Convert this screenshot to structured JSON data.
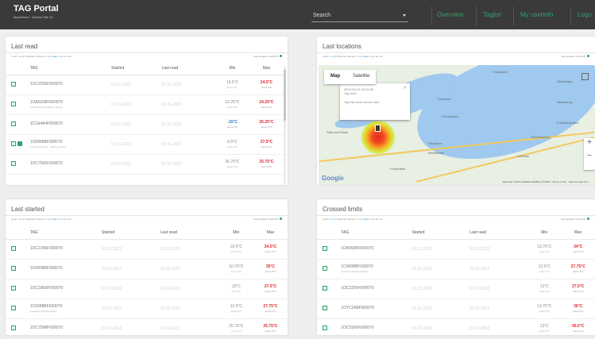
{
  "header": {
    "title": "TAG Portal",
    "subtitle": "MarcelVeni · Demos Site 44",
    "search_label": "Search",
    "nav": [
      "Overview",
      "Taglist",
      "My userinfo",
      "Logo"
    ]
  },
  "colors": {
    "accent": "#2fa36b",
    "max_red": "#e0262f",
    "min_blue": "#2f6fd6",
    "header_bg": "#3a3a3a"
  },
  "last_read": {
    "title": "Last read",
    "meta": {
      "prefix": "Count:",
      "count": "1 2 3 4",
      "text": "Refresh interval: 1 min",
      "link": "Code",
      "suffix": "5 min 10 min"
    },
    "updated": "Last updated: 12:01:06",
    "columns": [
      "",
      "TAG",
      "Started",
      "Last read",
      "Min",
      "Max"
    ],
    "rows": [
      {
        "tag": "1OC2256F000070",
        "sub": "",
        "started": "01.01.2022",
        "read": "01.01.2022",
        "min": "19.5°C",
        "min_sub": "since 3°C",
        "max": "24.5°C",
        "max_sub": "since 3°C",
        "min_blue": false,
        "double": false
      },
      {
        "tag": "1OA520BF000070",
        "sub": "Customer Stone Dustry Testing",
        "started": "01.01.2022",
        "read": "01.01.2022",
        "min": "10.25°C",
        "min_sub": "since 3°C",
        "max": "24.25°C",
        "max_sub": "since 3°C",
        "min_blue": false,
        "double": false
      },
      {
        "tag": "1C1A4A4F000070",
        "sub": "",
        "started": "01.01.2022",
        "read": "01.01.2022",
        "min": "-15°C",
        "min_sub": "since 3°C",
        "max": "25.25°C",
        "max_sub": "since 3°C",
        "min_blue": true,
        "double": false
      },
      {
        "tag": "1O6998BF000070",
        "sub": "Customer Sensor · Data p_sensor",
        "started": "01.01.2022",
        "read": "01.01.2022",
        "min": "6.5°C",
        "min_sub": "since 3°C",
        "max": "37.5°C",
        "max_sub": "since 3°C",
        "min_blue": false,
        "double": true
      },
      {
        "tag": "1OC7566F000070",
        "sub": "",
        "started": "01.01.2022",
        "read": "01.01.2022",
        "min": "25.75°C",
        "min_sub": "since 3°C",
        "max": "25.75°C",
        "max_sub": "since 3°C",
        "min_blue": false,
        "double": false
      }
    ]
  },
  "last_locations": {
    "title": "Last locations",
    "meta": {
      "prefix": "Count:",
      "count": "1 2 3 4",
      "text": "Refresh interval: 1 min",
      "link": "Code",
      "suffix": "5 min 10 min"
    },
    "updated": "Last updated: 12:01:06",
    "map_tab": "Map",
    "satellite_tab": "Satellite",
    "popup": {
      "time": "2023-06-09 18:40:49",
      "title": "Tag read",
      "body": "Tag has been above limit"
    },
    "google": "Google",
    "attribution": "Map data ©2023 GeoBasis-DE/BKG (©2009) · Terms of Use · Report a map error",
    "labels": [
      "Radolfzell",
      "Konstanz",
      "Kreuzlingen",
      "Stein am Rhein",
      "Frauenfeld",
      "Romanshorn",
      "Amriswil",
      "Weinfelden",
      "Steckborn",
      "Überlingen",
      "Meersburg",
      "Friedrichshafen"
    ]
  },
  "last_started": {
    "title": "Last started",
    "meta": {
      "prefix": "Count:",
      "count": "1 2 3 4",
      "text": "Refresh interval: 1 min",
      "link": "Code",
      "suffix": "5 min 10 min"
    },
    "updated": "Last updated: 12:01:06",
    "columns": [
      "",
      "TAG",
      "Started",
      "Last read",
      "Min",
      "Max"
    ],
    "rows": [
      {
        "tag": "1OC2256F000070",
        "sub": "",
        "started": "01.01.2022",
        "read": "01.01.2022",
        "min": "19.5°C",
        "min_sub": "since 3°C",
        "max": "24.5°C",
        "max_sub": "since 3°C"
      },
      {
        "tag": "1O4998BF000070",
        "sub": "",
        "started": "01.01.2022",
        "read": "01.01.2022",
        "min": "10.75°C",
        "min_sub": "since 3°C",
        "max": "35°C",
        "max_sub": "since 3°C"
      },
      {
        "tag": "1OC2A58F000070",
        "sub": "",
        "started": "01.01.2022",
        "read": "01.01.2022",
        "min": "13°C",
        "min_sub": "since 2C",
        "max": "27.5°C",
        "max_sub": "since 3°C"
      },
      {
        "tag": "1C6998BF000070",
        "sub": "Customer Documentation",
        "started": "01.01.2022",
        "read": "01.01.2022",
        "min": "12.5°C",
        "min_sub": "since 3°C",
        "max": "27.75°C",
        "max_sub": "since 3°C"
      },
      {
        "tag": "1OC7568F000070",
        "sub": "",
        "started": "01.01.2022",
        "read": "01.01.2022",
        "min": "25.75°C",
        "min_sub": "since 3°C",
        "max": "25.75°C",
        "max_sub": "since 3°C"
      }
    ]
  },
  "crossed_limits": {
    "title": "Crossed limits",
    "meta": {
      "prefix": "Count:",
      "count": "1 2 3 4",
      "text": "Refresh interval: 1 min",
      "link": "Code",
      "suffix": "5 min 10 min"
    },
    "updated": "Last updated: 12:01:06",
    "columns": [
      "",
      "TAG",
      "Started",
      "Last read",
      "Min",
      "Max"
    ],
    "rows": [
      {
        "tag": "1O4066BF000070",
        "sub": "",
        "started": "01.01.2022",
        "read": "01.01.2022",
        "min": "12.75°C",
        "min_sub": "since 3°C",
        "max": "34°C",
        "max_sub": "since 3°C"
      },
      {
        "tag": "1C6998BF000070",
        "sub": "Customer Documentation",
        "started": "01.01.2022",
        "read": "01.01.2022",
        "min": "12.5°C",
        "min_sub": "since 3°C",
        "max": "27.75°C",
        "max_sub": "since 3°C"
      },
      {
        "tag": "1OC2256F000070",
        "sub": "",
        "started": "01.01.2022",
        "read": "01.01.2022",
        "min": "13°C",
        "min_sub": "since 3°C",
        "max": "27.5°C",
        "max_sub": "since 3°C"
      },
      {
        "tag": "1OTC2A8F000070",
        "sub": "",
        "started": "01.01.2022",
        "read": "01.01.2022",
        "min": "13.75°C",
        "min_sub": "since 3°C",
        "max": "36°C",
        "max_sub": "since 3°C"
      },
      {
        "tag": "1OC0266F000070",
        "sub": "",
        "started": "01.01.2022",
        "read": "01.01.2022",
        "min": "13°C",
        "min_sub": "since 3°C",
        "max": "56.5°C",
        "max_sub": "since 3°C"
      }
    ]
  }
}
